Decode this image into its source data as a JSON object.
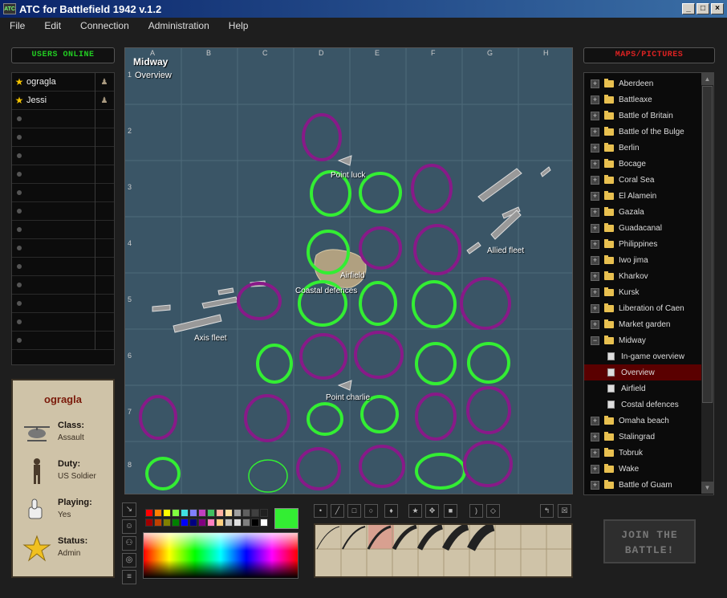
{
  "window": {
    "title": "ATC for Battlefield 1942 v.1.2",
    "icon": "app-icon",
    "min": "_",
    "max": "□",
    "close": "×"
  },
  "menu": [
    "File",
    "Edit",
    "Connection",
    "Administration",
    "Help"
  ],
  "users": {
    "header": "USERS ONLINE",
    "list": [
      {
        "name": "ogragla",
        "admin": true
      },
      {
        "name": "Jessi",
        "admin": true
      }
    ],
    "header_color": "#22cc22"
  },
  "profile": {
    "name": "ogragla",
    "class_label": "Class:",
    "class_value": "Assault",
    "duty_label": "Duty:",
    "duty_value": "US Soldier",
    "playing_label": "Playing:",
    "playing_value": "Yes",
    "status_label": "Status:",
    "status_value": "Admin"
  },
  "map": {
    "title": "Midway",
    "subtitle": "Overview",
    "columns": [
      "A",
      "B",
      "C",
      "D",
      "E",
      "F",
      "G",
      "H"
    ],
    "rows": [
      "1",
      "2",
      "3",
      "4",
      "5",
      "6",
      "7",
      "8"
    ],
    "labels": {
      "point_luck": "Point luck",
      "allied_fleet": "Allied fleet",
      "airfield": "Airfield",
      "coastal": "Coastal defences",
      "axis_fleet": "Axis fleet",
      "point_charlie": "Point charlie"
    }
  },
  "maps_panel": {
    "header": "MAPS/PICTURES",
    "header_color": "#dd2222",
    "items": [
      {
        "label": "Aberdeen",
        "type": "folder"
      },
      {
        "label": "Battleaxe",
        "type": "folder"
      },
      {
        "label": "Battle of Britain",
        "type": "folder"
      },
      {
        "label": "Battle of the Bulge",
        "type": "folder"
      },
      {
        "label": "Berlin",
        "type": "folder"
      },
      {
        "label": "Bocage",
        "type": "folder"
      },
      {
        "label": "Coral Sea",
        "type": "folder"
      },
      {
        "label": "El Alamein",
        "type": "folder"
      },
      {
        "label": "Gazala",
        "type": "folder"
      },
      {
        "label": "Guadacanal",
        "type": "folder"
      },
      {
        "label": "Philippines",
        "type": "folder"
      },
      {
        "label": "Iwo jima",
        "type": "folder"
      },
      {
        "label": "Kharkov",
        "type": "folder"
      },
      {
        "label": "Kursk",
        "type": "folder"
      },
      {
        "label": "Liberation of Caen",
        "type": "folder"
      },
      {
        "label": "Market garden",
        "type": "folder"
      },
      {
        "label": "Midway",
        "type": "folder-open"
      },
      {
        "label": "In-game overview",
        "type": "doc"
      },
      {
        "label": "Overview",
        "type": "doc",
        "selected": true
      },
      {
        "label": "Airfield",
        "type": "doc"
      },
      {
        "label": "Costal defences",
        "type": "doc"
      },
      {
        "label": "Omaha beach",
        "type": "folder"
      },
      {
        "label": "Stalingrad",
        "type": "folder"
      },
      {
        "label": "Tobruk",
        "type": "folder"
      },
      {
        "label": "Wake",
        "type": "folder"
      },
      {
        "label": "Battle of Guam",
        "type": "folder"
      }
    ]
  },
  "join": {
    "line1": "JOIN THE",
    "line2": "BATTLE!"
  },
  "colors": {
    "current": "#33ee33",
    "accent_red": "#7a1a0a",
    "selected_row": "#5a0000"
  }
}
